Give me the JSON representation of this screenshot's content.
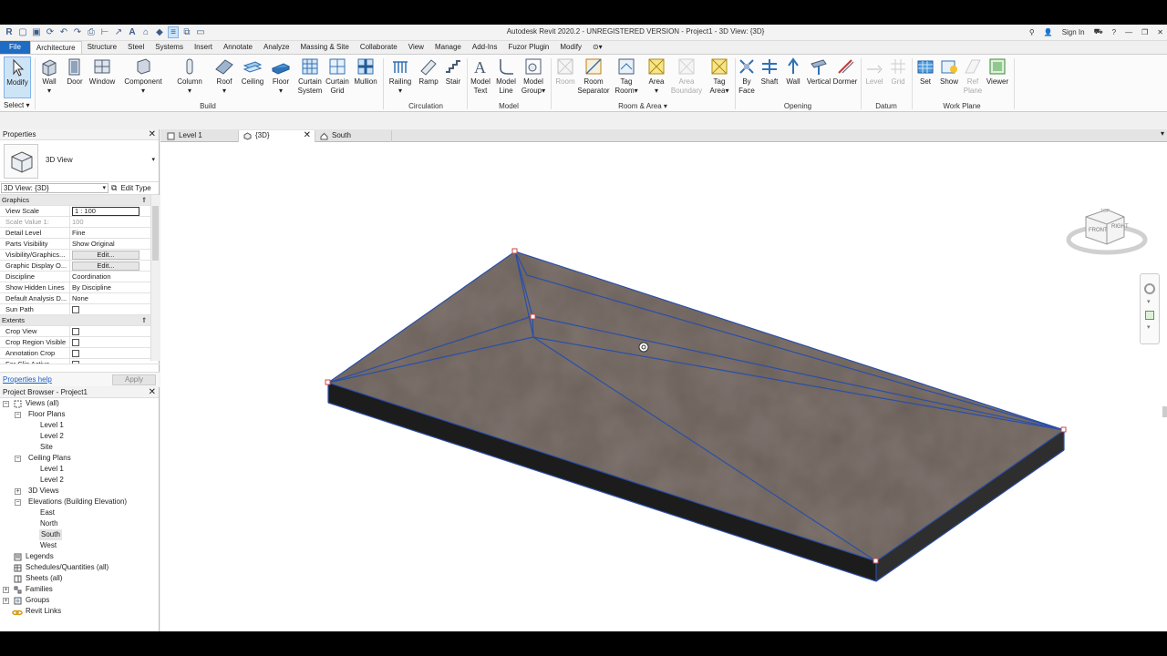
{
  "titlebar": {
    "app_logo": "R",
    "title": "Autodesk Revit 2020.2 - UNREGISTERED VERSION - Project1 - 3D View: {3D}",
    "sign_in": "Sign In"
  },
  "ribbon_tabs": [
    "File",
    "Architecture",
    "Structure",
    "Steel",
    "Systems",
    "Insert",
    "Annotate",
    "Analyze",
    "Massing & Site",
    "Collaborate",
    "View",
    "Manage",
    "Add-Ins",
    "Fuzor Plugin",
    "Modify"
  ],
  "ribbon": {
    "modify": "Modify",
    "select": "Select",
    "build": [
      "Wall",
      "Door",
      "Window",
      "Component",
      "Column",
      "Roof",
      "Ceiling",
      "Floor"
    ],
    "curtain_system": [
      "Curtain",
      "System"
    ],
    "curtain_grid": [
      "Curtain",
      "Grid"
    ],
    "mullion": "Mullion",
    "circulation": [
      "Railing",
      "Ramp",
      "Stair"
    ],
    "model_text": [
      "Model",
      "Text"
    ],
    "model_line": [
      "Model",
      "Line"
    ],
    "model_group": [
      "Model",
      "Group"
    ],
    "room": "Room",
    "room_separator": [
      "Room",
      "Separator"
    ],
    "tag_room": [
      "Tag",
      "Room"
    ],
    "area": "Area",
    "area_boundary": [
      "Area",
      "Boundary"
    ],
    "tag_area": [
      "Tag",
      "Area"
    ],
    "by_face": [
      "By",
      "Face"
    ],
    "opening": [
      "Shaft",
      "Wall",
      "Vertical",
      "Dormer"
    ],
    "datum": [
      "Level",
      "Grid"
    ],
    "work_plane": [
      "Set",
      "Show"
    ],
    "ref_plane": [
      "Ref",
      "Plane"
    ],
    "viewer": "Viewer",
    "panels": {
      "build": "Build",
      "circulation": "Circulation",
      "model": "Model",
      "room_area": "Room & Area",
      "opening": "Opening",
      "datum": "Datum",
      "work_plane": "Work Plane"
    }
  },
  "properties": {
    "title": "Properties",
    "type_name": "3D View",
    "instance": "3D View: {3D}",
    "edit_type": "Edit Type",
    "graphics_label": "Graphics",
    "rows": [
      {
        "k": "View Scale",
        "v": "1 : 100"
      },
      {
        "k": "Scale Value    1:",
        "v": "100"
      },
      {
        "k": "Detail Level",
        "v": "Fine"
      },
      {
        "k": "Parts Visibility",
        "v": "Show Original"
      },
      {
        "k": "Visibility/Graphics...",
        "v": "Edit..."
      },
      {
        "k": "Graphic Display O...",
        "v": "Edit..."
      },
      {
        "k": "Discipline",
        "v": "Coordination"
      },
      {
        "k": "Show Hidden Lines",
        "v": "By Discipline"
      },
      {
        "k": "Default Analysis D...",
        "v": "None"
      },
      {
        "k": "Sun Path",
        "v": ""
      }
    ],
    "extents_label": "Extents",
    "extents": [
      "Crop View",
      "Crop Region Visible",
      "Annotation Crop",
      "Far Clip Active"
    ],
    "help": "Properties help",
    "apply": "Apply"
  },
  "browser": {
    "title": "Project Browser - Project1",
    "views": "Views (all)",
    "floor_plans": "Floor Plans",
    "floor_items": [
      "Level 1",
      "Level 2",
      "Site"
    ],
    "ceiling_plans": "Ceiling Plans",
    "ceiling_items": [
      "Level 1",
      "Level 2"
    ],
    "views_3d": "3D Views",
    "elevations": "Elevations (Building Elevation)",
    "elevation_items": [
      "East",
      "North",
      "South",
      "West"
    ],
    "legends": "Legends",
    "schedules": "Schedules/Quantities (all)",
    "sheets": "Sheets (all)",
    "families": "Families",
    "groups": "Groups",
    "revit_links": "Revit Links"
  },
  "view_tabs": [
    "Level 1",
    "{3D}",
    "South"
  ],
  "viewcube": {
    "front": "FRONT",
    "right": "RIGHT",
    "top": "TOP"
  },
  "colors": {
    "accent": "#1f6cc4",
    "slab_top": "#7a6e68",
    "slab_side": "#262626",
    "edge": "#2a4fa8"
  }
}
